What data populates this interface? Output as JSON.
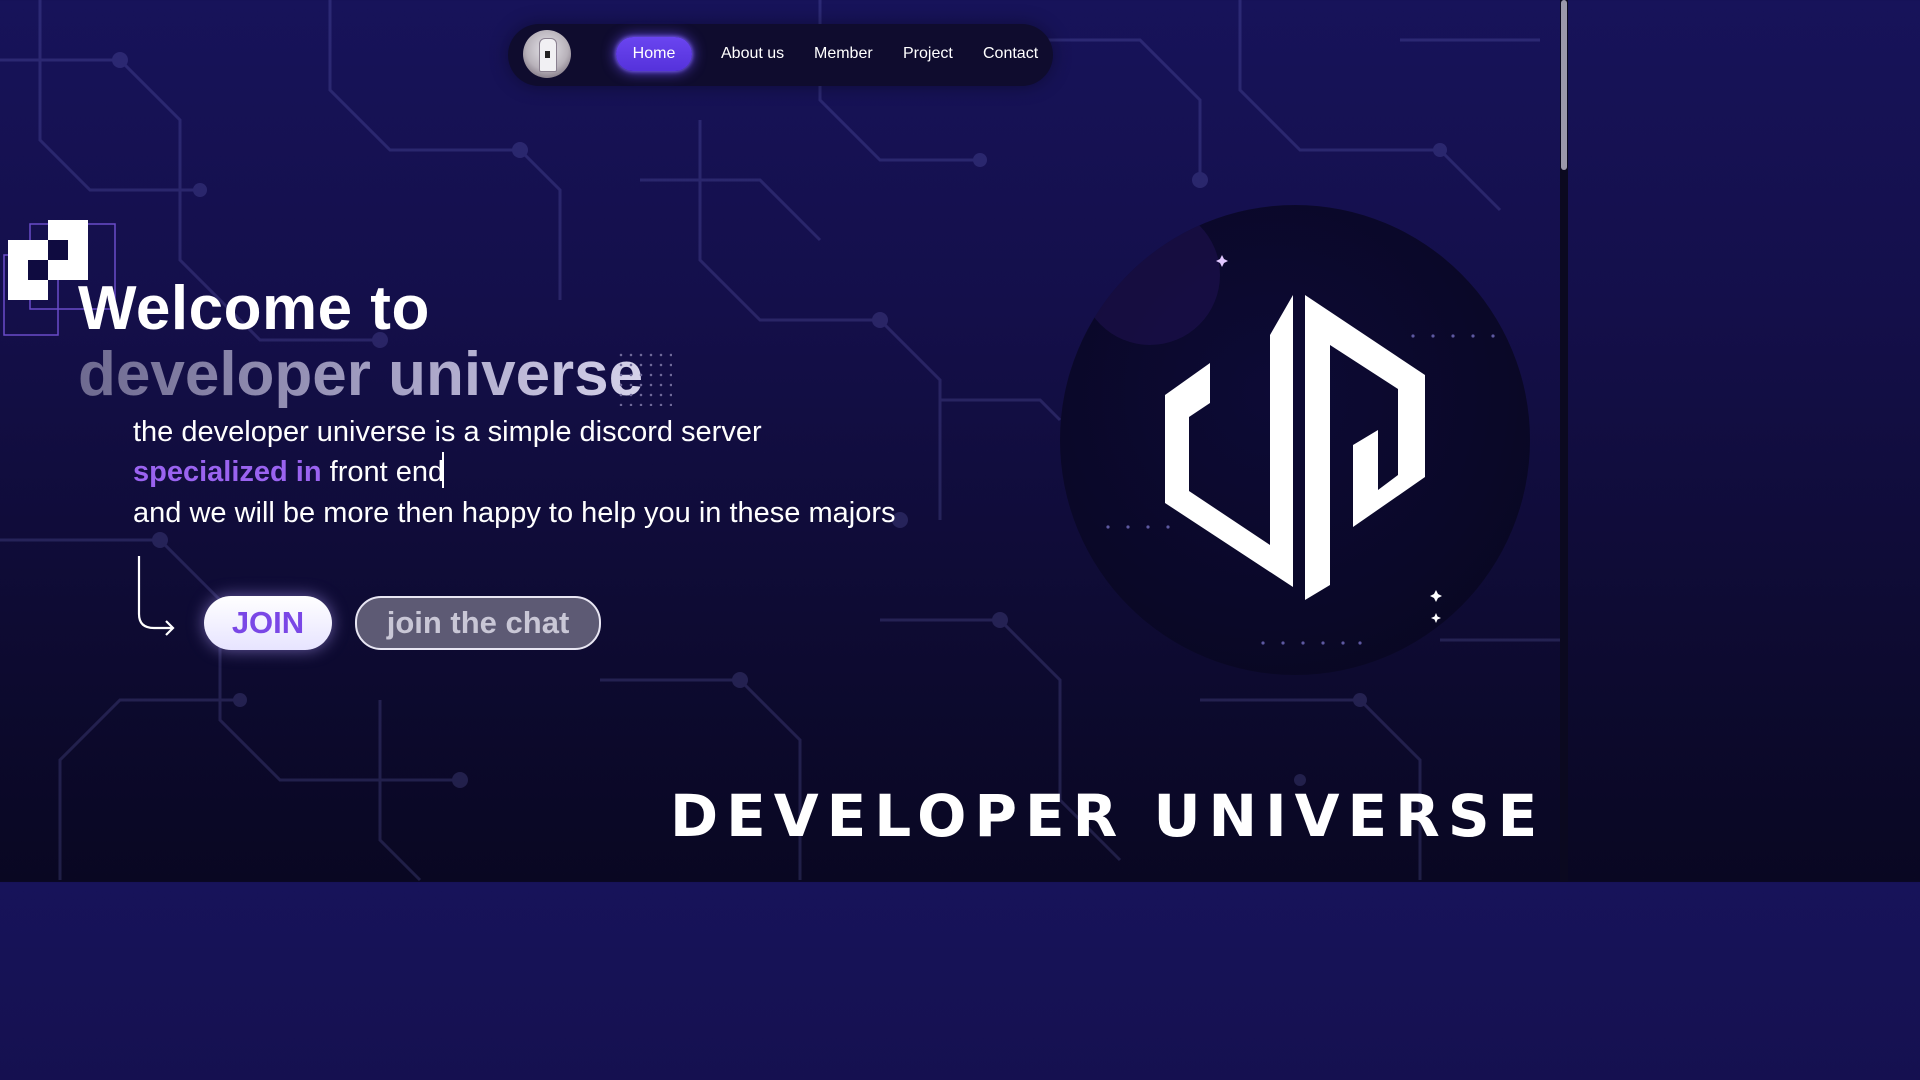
{
  "nav": {
    "avatar_icon": "profile-avatar",
    "items": [
      {
        "label": "Home",
        "active": true
      },
      {
        "label": "About us",
        "active": false
      },
      {
        "label": "Member",
        "active": false
      },
      {
        "label": "Project",
        "active": false
      },
      {
        "label": "Contact",
        "active": false
      }
    ]
  },
  "hero": {
    "title_line1": "Welcome to",
    "title_line2": "developer universe",
    "desc_line1": "the developer universe is a simple discord server",
    "desc_line2_highlight": "specialized in",
    "desc_line2_text": " front end",
    "desc_line3": "and we will be more then happy to help you in these majors",
    "join_label": "JOIN",
    "chat_label": "join the chat"
  },
  "brand": {
    "text": "DEVELOPER UNIVERSE",
    "logo_icon": "developer-universe-logo",
    "squares_icon": "pixel-squares-logo"
  },
  "colors": {
    "accent": "#6a45f0",
    "highlight": "#9a63f0",
    "background": "#140f4a"
  }
}
